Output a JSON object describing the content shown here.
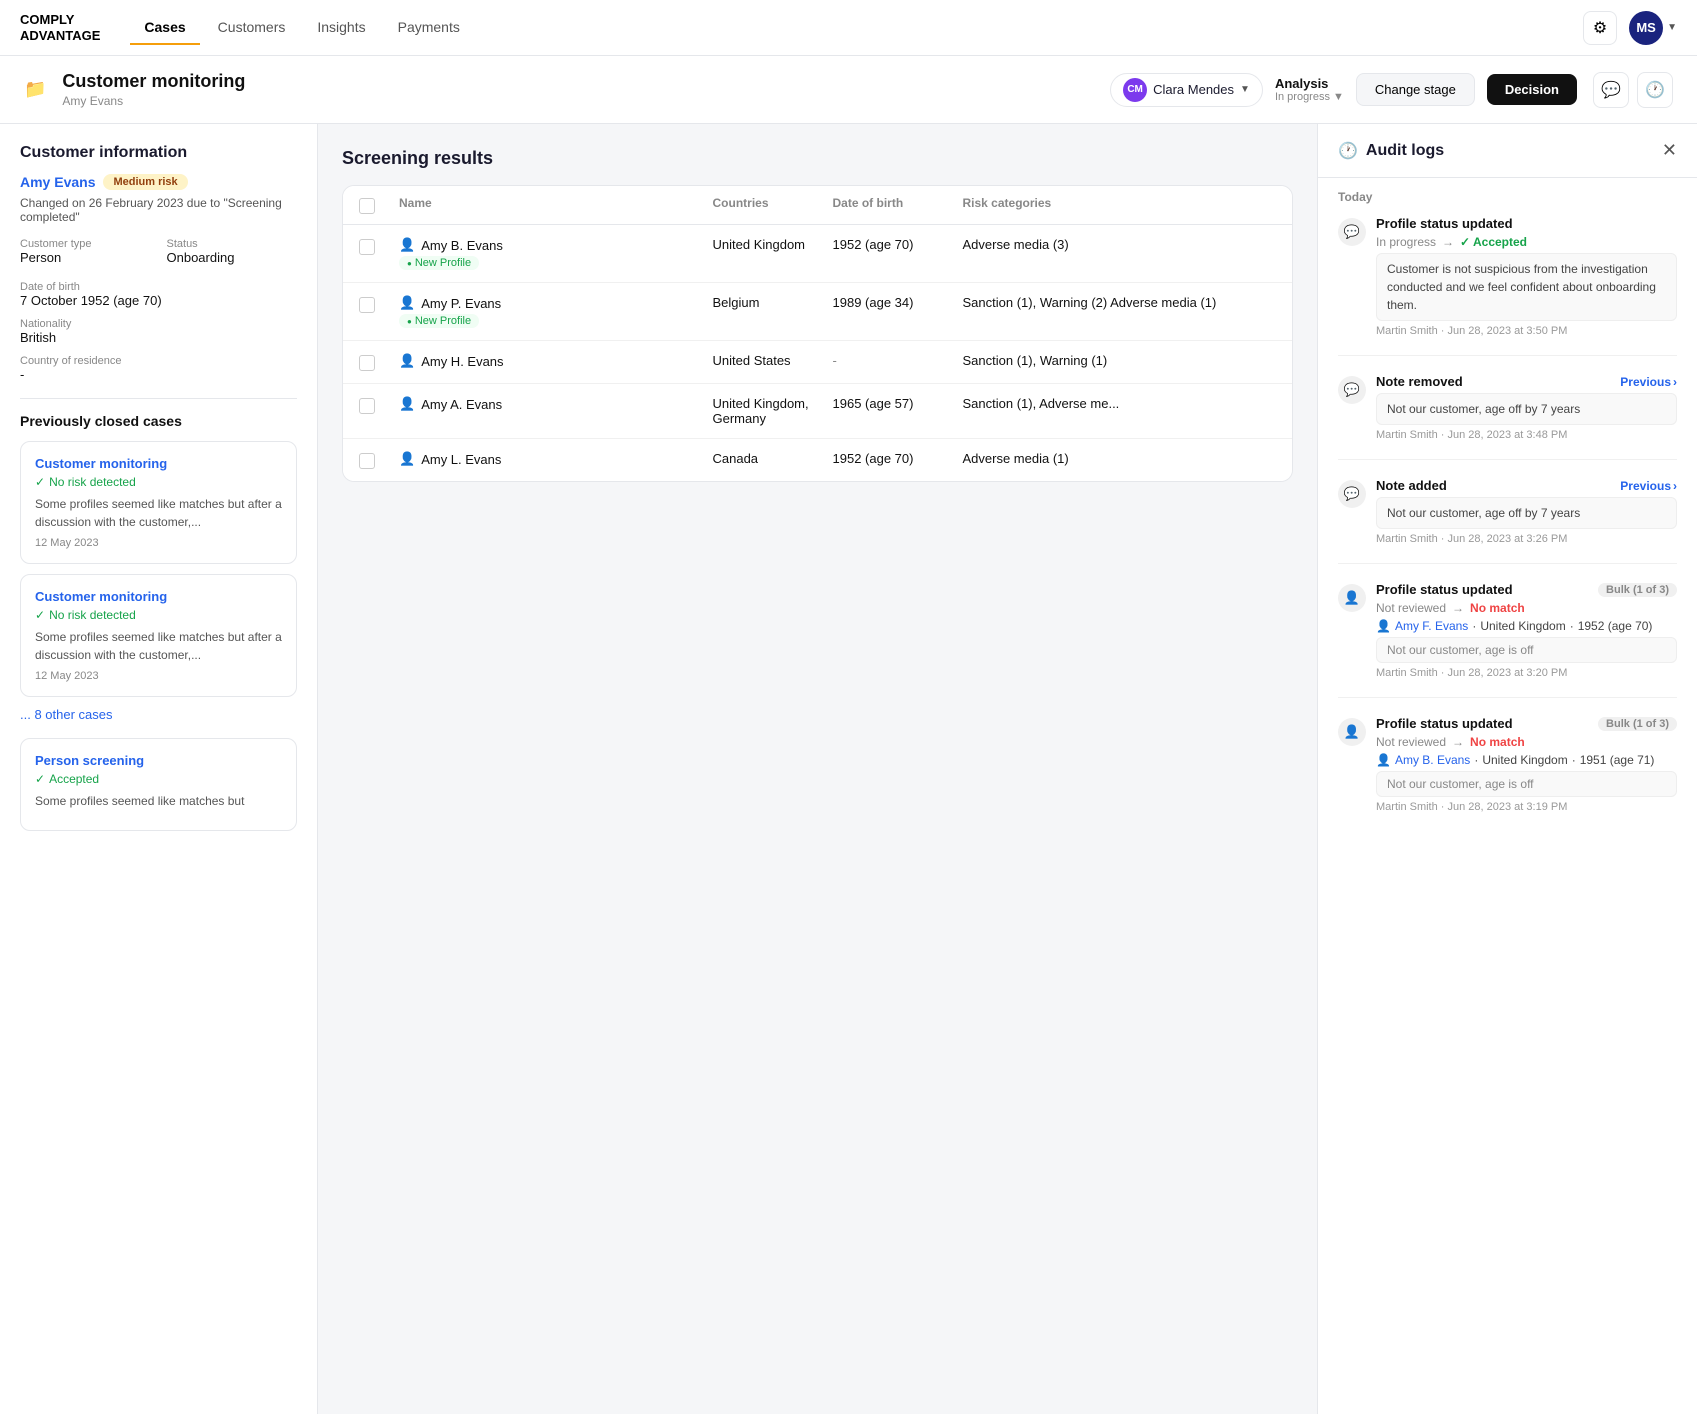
{
  "brand": {
    "logo_line1": "COMPLY",
    "logo_line2": "ADVANTAGE"
  },
  "nav": {
    "links": [
      {
        "id": "cases",
        "label": "Cases",
        "active": true
      },
      {
        "id": "customers",
        "label": "Customers",
        "active": false
      },
      {
        "id": "insights",
        "label": "Insights",
        "active": false
      },
      {
        "id": "payments",
        "label": "Payments",
        "active": false
      }
    ],
    "user_initials": "MS"
  },
  "case_header": {
    "icon": "📁",
    "title": "Customer monitoring",
    "subtitle": "Amy Evans",
    "assignee_initials": "CM",
    "assignee_name": "Clara Mendes",
    "stage_label": "Analysis",
    "stage_status": "In progress",
    "change_stage_label": "Change stage",
    "decision_label": "Decision"
  },
  "left_panel": {
    "section_title": "Customer information",
    "customer_name": "Amy Evans",
    "risk_label": "Medium risk",
    "change_note": "Changed on 26 February 2023 due to \"Screening completed\"",
    "customer_type_label": "Customer type",
    "customer_type_value": "Person",
    "status_label": "Status",
    "status_value": "Onboarding",
    "dob_label": "Date of birth",
    "dob_value": "7 October 1952 (age 70)",
    "nationality_label": "Nationality",
    "nationality_value": "British",
    "residence_label": "Country of residence",
    "residence_value": "-",
    "prev_cases_title": "Previously closed cases",
    "cases": [
      {
        "link": "Customer monitoring",
        "status": "No risk detected",
        "desc": "Some profiles seemed like matches but after a discussion with the customer,...",
        "date": "12 May 2023"
      },
      {
        "link": "Customer monitoring",
        "status": "No risk detected",
        "desc": "Some profiles seemed like matches but after a discussion with the customer,...",
        "date": "12 May 2023"
      }
    ],
    "other_cases_link": "... 8 other cases",
    "person_screening": {
      "link": "Person screening",
      "status": "Accepted",
      "desc": "Some profiles seemed like matches but"
    }
  },
  "screening": {
    "title": "Screening results",
    "columns": [
      "",
      "Name",
      "Countries",
      "Date of birth",
      "Risk categories"
    ],
    "rows": [
      {
        "name": "Amy B. Evans",
        "tag": "New Profile",
        "country": "United Kingdom",
        "dob": "1952 (age 70)",
        "risk": "Adverse media (3)"
      },
      {
        "name": "Amy P. Evans",
        "tag": "New Profile",
        "country": "Belgium",
        "dob": "1989 (age 34)",
        "risk": "Sanction (1), Warning (2) Adverse media (1)"
      },
      {
        "name": "Amy H. Evans",
        "tag": "",
        "country": "United States",
        "dob": "-",
        "risk": "Sanction (1), Warning (1)"
      },
      {
        "name": "Amy A. Evans",
        "tag": "",
        "country": "United Kingdom, Germany",
        "dob": "1965 (age 57)",
        "risk": "Sanction (1), Adverse me..."
      },
      {
        "name": "Amy L. Evans",
        "tag": "",
        "country": "Canada",
        "dob": "1952 (age 70)",
        "risk": "Adverse media (1)"
      }
    ]
  },
  "audit_logs": {
    "title": "Audit logs",
    "day_label": "Today",
    "items": [
      {
        "icon": "💬",
        "event": "Profile status updated",
        "bulk": "",
        "status_from": "In progress",
        "status_to": "✓ Accepted",
        "note": "Customer is not suspicious from the investigation conducted and we feel confident about onboarding them.",
        "meta": "Martin Smith · Jun 28, 2023 at 3:50 PM",
        "has_previous": false
      },
      {
        "icon": "💬",
        "event": "Note removed",
        "bulk": "",
        "status_from": "",
        "status_to": "",
        "note": "Not our customer, age off by 7 years",
        "meta": "Martin Smith · Jun 28, 2023 at 3:48 PM",
        "has_previous": true,
        "previous_label": "Previous"
      },
      {
        "icon": "💬",
        "event": "Note added",
        "bulk": "",
        "status_from": "",
        "status_to": "",
        "note": "Not our customer, age off by 7 years",
        "meta": "Martin Smith · Jun 28, 2023 at 3:26 PM",
        "has_previous": true,
        "previous_label": "Previous"
      },
      {
        "icon": "👤",
        "event": "Profile status updated",
        "bulk": "Bulk (1 of 3)",
        "status_from": "Not reviewed",
        "status_to": "No match",
        "profile_name": "Amy F. Evans",
        "profile_country": "United Kingdom",
        "profile_year": "1952 (age 70)",
        "sub_note": "Not our customer, age is off",
        "meta": "Martin Smith · Jun 28, 2023 at 3:20 PM",
        "has_previous": false
      },
      {
        "icon": "👤",
        "event": "Profile status updated",
        "bulk": "Bulk (1 of 3)",
        "status_from": "Not reviewed",
        "status_to": "No match",
        "profile_name": "Amy B. Evans",
        "profile_country": "United Kingdom",
        "profile_year": "1951 (age 71)",
        "sub_note": "Not our customer, age is off",
        "meta": "Martin Smith · Jun 28, 2023 at 3:19 PM",
        "has_previous": false
      }
    ]
  }
}
